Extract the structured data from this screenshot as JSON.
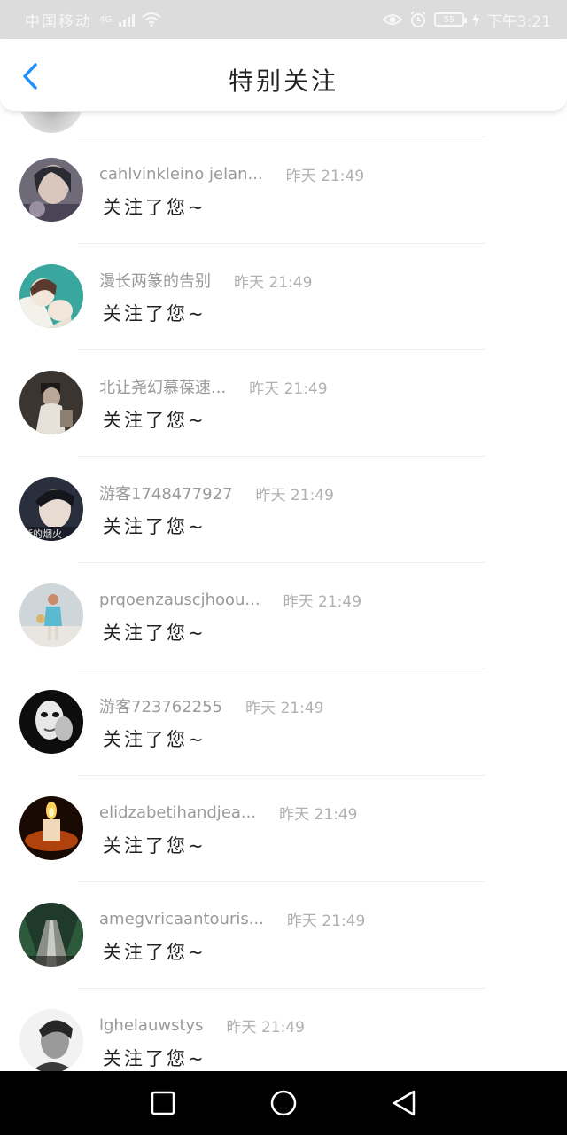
{
  "status_bar": {
    "carrier": "中国移动",
    "network": "4G",
    "battery": "55",
    "time": "下午3:21",
    "icons": [
      "signal-icon",
      "wifi-icon",
      "eye-icon",
      "alarm-icon",
      "battery-icon",
      "charging-icon"
    ]
  },
  "header": {
    "title": "特别关注",
    "back_icon": "chevron-left-icon",
    "accent_color": "#1e90ff"
  },
  "items": [
    {
      "name": "cahlvinkleino jelan...",
      "time": "昨天 21:49",
      "message": "关注了您~",
      "avatar": "portrait"
    },
    {
      "name": "漫长两篆的告别",
      "time": "昨天 21:49",
      "message": "关注了您~",
      "avatar": "cartoon"
    },
    {
      "name": "北让尧幻慕葆速...",
      "time": "昨天 21:49",
      "message": "关注了您~",
      "avatar": "dark-portrait"
    },
    {
      "name": "游客1748477927",
      "time": "昨天 21:49",
      "message": "关注了您~",
      "avatar": "face",
      "avatar_text": "逝的烟火"
    },
    {
      "name": "prqoenzauscjhoou...",
      "time": "昨天 21:49",
      "message": "关注了您~",
      "avatar": "outdoor"
    },
    {
      "name": "游客723762255",
      "time": "昨天 21:49",
      "message": "关注了您~",
      "avatar": "mask"
    },
    {
      "name": "elidzabetihandjea...",
      "time": "昨天 21:49",
      "message": "关注了您~",
      "avatar": "candle"
    },
    {
      "name": "amegvricaantouris...",
      "time": "昨天 21:49",
      "message": "关注了您~",
      "avatar": "bridge"
    },
    {
      "name": "lghelauwstys",
      "time": "昨天 21:49",
      "message": "关注了您~",
      "avatar": "bw-portrait"
    }
  ],
  "nav_bar": {
    "buttons": [
      "recent-apps-icon",
      "home-icon",
      "back-triangle-icon"
    ]
  }
}
